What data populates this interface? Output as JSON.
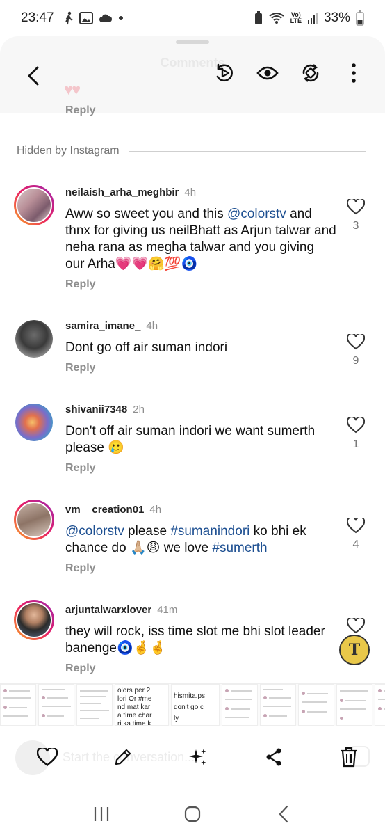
{
  "status_bar": {
    "time": "23:47",
    "battery": "33%",
    "network": "Vo) LTE"
  },
  "sheet": {
    "title": "Comments",
    "top_reply": "Reply"
  },
  "hidden_section": {
    "label": "Hidden by Instagram"
  },
  "comments": [
    {
      "username": "neilaish_arha_meghbir",
      "time": "4h",
      "text_parts": [
        "Aww so sweet you and this ",
        "@colorstv",
        "  and thnx for giving us neilBhatt as Arjun talwar and neha rana as megha talwar and you giving our Arha💗💗🤗💯🧿"
      ],
      "likes": "3",
      "reply": "Reply"
    },
    {
      "username": "samira_imane_",
      "time": "4h",
      "text": "Dont go off air suman indori",
      "likes": "9",
      "reply": "Reply"
    },
    {
      "username": "shivanii7348",
      "time": "2h",
      "text": "Don't off air suman indori we want sumerth please 🥲",
      "likes": "1",
      "reply": "Reply"
    },
    {
      "username": "vm__creation01",
      "time": "4h",
      "text_parts": [
        "@colorstv",
        " please ",
        "#sumanindori",
        " ko bhi ek chance do 🙏🏼😩 we love ",
        "#sumerth"
      ],
      "likes": "4",
      "reply": "Reply"
    },
    {
      "username": "arjuntalwarxlover",
      "time": "41m",
      "text": "they will rock, iss time slot me bhi slot leader banenge🧿🤞🤞",
      "reply": "Reply"
    }
  ],
  "thumb_texts": {
    "t1": [
      "olors per 2",
      "lori Or #me",
      "nd mat kar",
      "a time char",
      "ri ka time k"
    ],
    "t2": [
      "hismita.ps",
      "don't go c",
      "ly"
    ]
  },
  "composer": {
    "placeholder": "Start the conversation..."
  },
  "translate_button": "T",
  "colors": {
    "mention": "#1d4f91",
    "secondary_text": "#8e8e8e",
    "translate_fab": "#e9c84a"
  }
}
